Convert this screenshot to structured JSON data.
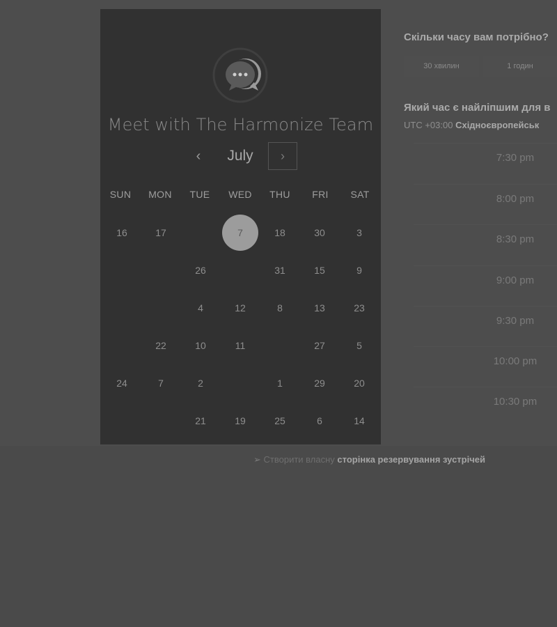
{
  "calendar": {
    "title": "Meet with The Harmonize Team",
    "month": "July",
    "prev_icon": "‹",
    "next_icon": "›",
    "weekdays": [
      "SUN",
      "MON",
      "TUE",
      "WED",
      "THU",
      "FRI",
      "SAT"
    ],
    "days": [
      [
        "16",
        "17",
        "",
        "7",
        "18",
        "30",
        "3"
      ],
      [
        "",
        "",
        "26",
        "",
        "31",
        "15",
        "9"
      ],
      [
        "",
        "",
        "4",
        "12",
        "8",
        "13",
        "23"
      ],
      [
        "",
        "22",
        "10",
        "11",
        "",
        "27",
        "5"
      ],
      [
        "24",
        "7",
        "2",
        "",
        "1",
        "29",
        "20"
      ],
      [
        "",
        "",
        "21",
        "19",
        "25",
        "6",
        "14"
      ]
    ],
    "selected_day": "7"
  },
  "booking": {
    "duration_question": "Скільки часу вам потрібно?",
    "duration_options": [
      "30 хвилин",
      "1 годин"
    ],
    "time_question": "Який час є найліпшим для в",
    "timezone_offset": "UTC +03:00",
    "timezone_name": "Східноєвропейськ",
    "slots": [
      "7:30 pm",
      "8:00 pm",
      "8:30 pm",
      "9:00 pm",
      "9:30 pm",
      "10:00 pm",
      "10:30 pm"
    ]
  },
  "footer": {
    "arrow": "➢",
    "lead": "Створити власну",
    "link": "сторінка резервування зустрічей"
  },
  "colors": {
    "background": "#4a4a4a",
    "card": "#313131",
    "selected_day": "#9c9c9c"
  }
}
